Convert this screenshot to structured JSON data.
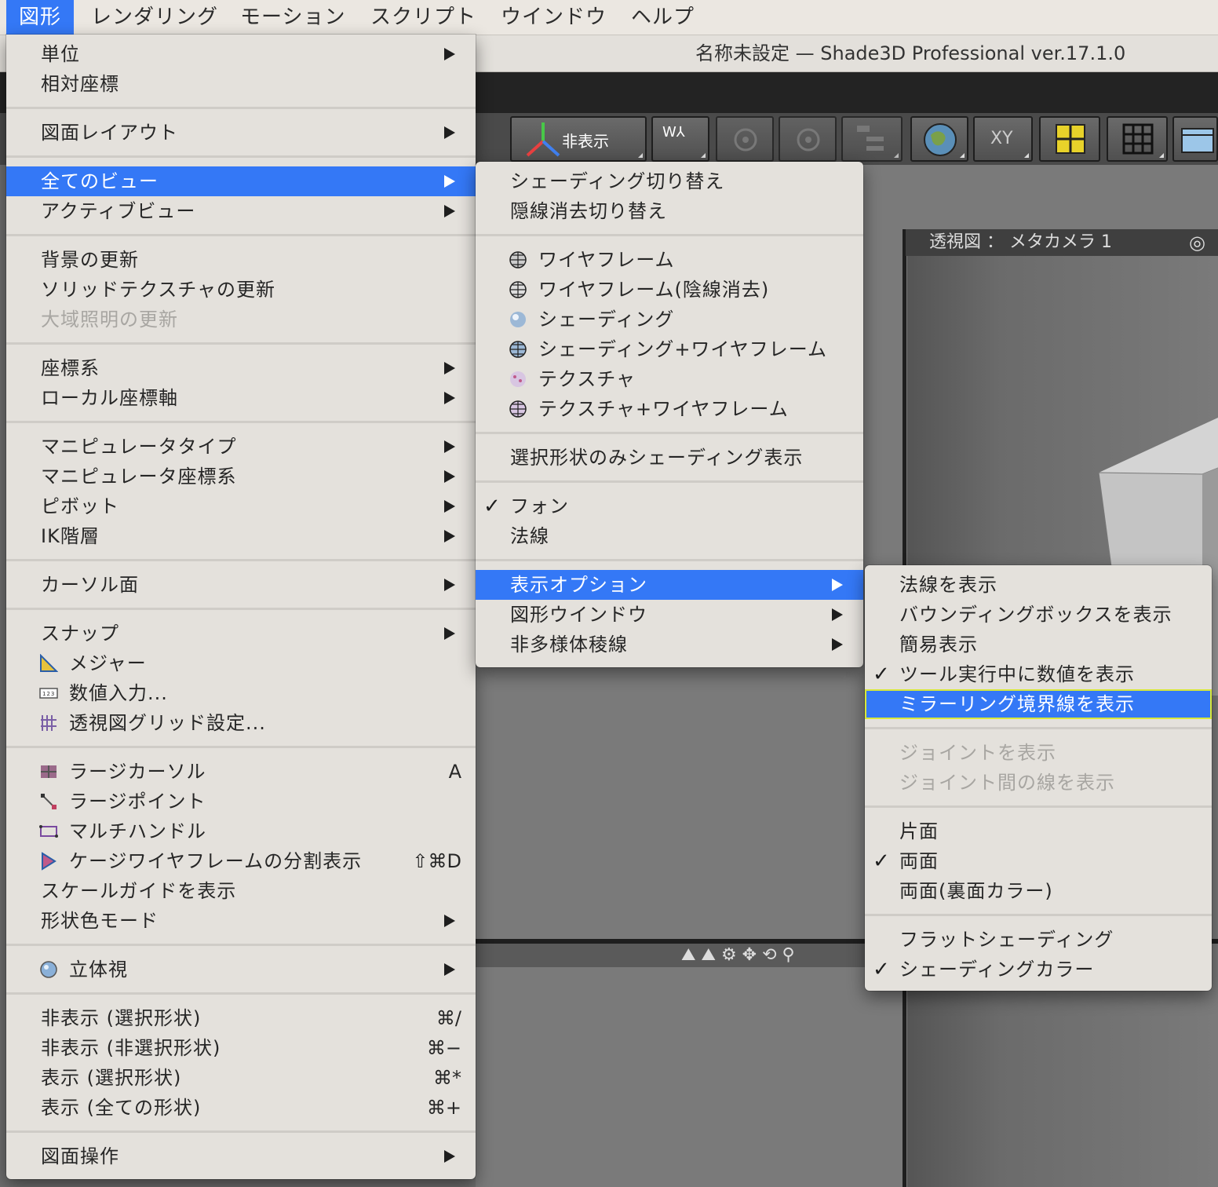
{
  "menubar": {
    "items": [
      "図形",
      "レンダリング",
      "モーション",
      "スクリプト",
      "ウインドウ",
      "ヘルプ"
    ]
  },
  "window": {
    "title": "名称未設定 — Shade3D Professional ver.17.1.0",
    "toolbar_hidden_label": "非表示",
    "toolbar_xy_label": "XY",
    "view_title": "透視図 ： メタカメラ 1"
  },
  "main_menu": {
    "items": [
      {
        "label": "単位",
        "submenu": true
      },
      {
        "label": "相対座標"
      },
      {
        "label": "図面レイアウト",
        "submenu": true
      },
      {
        "label": "全てのビュー",
        "submenu": true,
        "highlighted": true
      },
      {
        "label": "アクティブビュー",
        "submenu": true
      },
      {
        "label": "背景の更新"
      },
      {
        "label": "ソリッドテクスチャの更新"
      },
      {
        "label": "大域照明の更新",
        "disabled": true
      },
      {
        "label": "座標系",
        "submenu": true
      },
      {
        "label": "ローカル座標軸",
        "submenu": true
      },
      {
        "label": "マニピュレータタイプ",
        "submenu": true
      },
      {
        "label": "マニピュレータ座標系",
        "submenu": true
      },
      {
        "label": "ピボット",
        "submenu": true
      },
      {
        "label": "IK階層",
        "submenu": true
      },
      {
        "label": "カーソル面",
        "submenu": true
      },
      {
        "label": "スナップ",
        "submenu": true
      },
      {
        "label": "メジャー",
        "icon": "measure-icon"
      },
      {
        "label": "数値入力...",
        "icon": "numeric-input-icon"
      },
      {
        "label": "透視図グリッド設定...",
        "icon": "grid-settings-icon"
      },
      {
        "label": "ラージカーソル",
        "icon": "large-cursor-icon",
        "shortcut": "A"
      },
      {
        "label": "ラージポイント",
        "icon": "large-point-icon"
      },
      {
        "label": "マルチハンドル",
        "icon": "multi-handle-icon"
      },
      {
        "label": "ケージワイヤフレームの分割表示",
        "icon": "cage-wireframe-icon",
        "shortcut": "⇧⌘D"
      },
      {
        "label": "スケールガイドを表示"
      },
      {
        "label": "形状色モード",
        "submenu": true
      },
      {
        "label": "立体視",
        "icon": "stereo-icon",
        "submenu": true
      },
      {
        "label": "非表示 (選択形状)",
        "shortcut": "⌘/"
      },
      {
        "label": "非表示 (非選択形状)",
        "shortcut": "⌘−"
      },
      {
        "label": "表示 (選択形状)",
        "shortcut": "⌘*"
      },
      {
        "label": "表示 (全ての形状)",
        "shortcut": "⌘+"
      },
      {
        "label": "図面操作",
        "submenu": true
      }
    ]
  },
  "views_menu": {
    "items": [
      {
        "label": "シェーディング切り替え"
      },
      {
        "label": "隠線消去切り替え"
      },
      {
        "label": "ワイヤフレーム",
        "icon": "wireframe-icon"
      },
      {
        "label": "ワイヤフレーム(陰線消去)",
        "icon": "wireframe-hidden-icon"
      },
      {
        "label": "シェーディング",
        "icon": "shading-icon"
      },
      {
        "label": "シェーディング+ワイヤフレーム",
        "icon": "shading-wireframe-icon"
      },
      {
        "label": "テクスチャ",
        "icon": "texture-icon"
      },
      {
        "label": "テクスチャ+ワイヤフレーム",
        "icon": "texture-wireframe-icon"
      },
      {
        "label": "選択形状のみシェーディング表示"
      },
      {
        "label": "フォン",
        "checked": true
      },
      {
        "label": "法線"
      },
      {
        "label": "表示オプション",
        "submenu": true,
        "highlighted": true
      },
      {
        "label": "図形ウインドウ",
        "submenu": true
      },
      {
        "label": "非多様体稜線",
        "submenu": true
      }
    ]
  },
  "display_options_menu": {
    "items": [
      {
        "label": "法線を表示"
      },
      {
        "label": "バウンディングボックスを表示"
      },
      {
        "label": "簡易表示"
      },
      {
        "label": "ツール実行中に数値を表示",
        "checked": true
      },
      {
        "label": "ミラーリング境界線を表示",
        "highlighted": true
      },
      {
        "label": "ジョイントを表示",
        "disabled": true
      },
      {
        "label": "ジョイント間の線を表示",
        "disabled": true
      },
      {
        "label": "片面"
      },
      {
        "label": "両面",
        "checked": true
      },
      {
        "label": "両面(裏面カラー)"
      },
      {
        "label": "フラットシェーディング"
      },
      {
        "label": "シェーディングカラー",
        "checked": true
      }
    ]
  },
  "colors": {
    "highlight": "#3478f6",
    "menu_bg": "#e4e1dc",
    "disabled_text": "#a8a6a2"
  }
}
